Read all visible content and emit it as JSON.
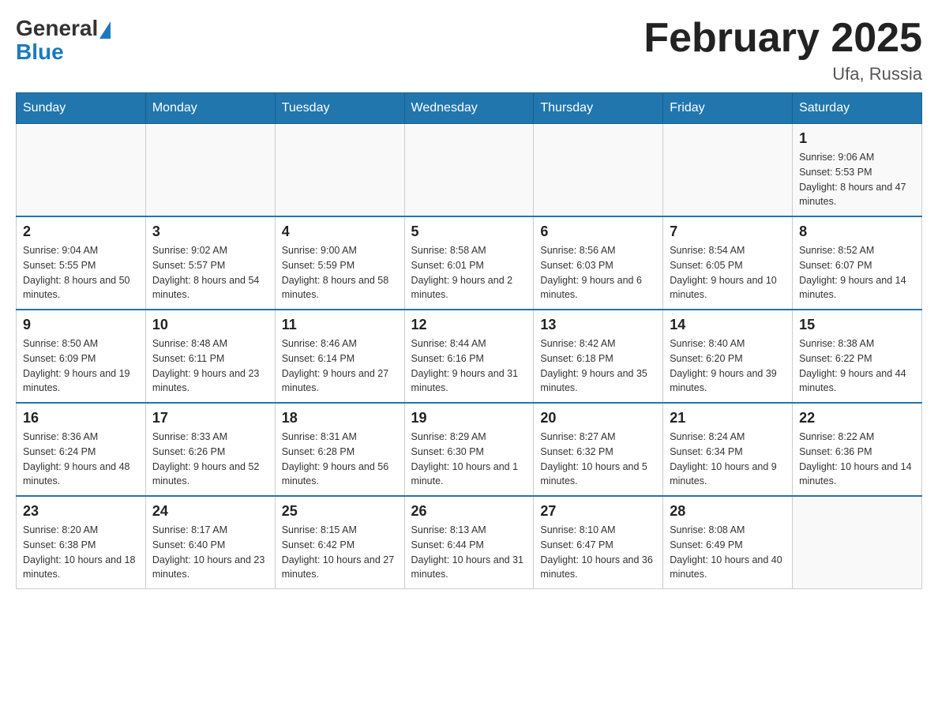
{
  "header": {
    "logo_general": "General",
    "logo_blue": "Blue",
    "title": "February 2025",
    "location": "Ufa, Russia"
  },
  "days_of_week": [
    "Sunday",
    "Monday",
    "Tuesday",
    "Wednesday",
    "Thursday",
    "Friday",
    "Saturday"
  ],
  "weeks": [
    [
      {
        "day": "",
        "info": ""
      },
      {
        "day": "",
        "info": ""
      },
      {
        "day": "",
        "info": ""
      },
      {
        "day": "",
        "info": ""
      },
      {
        "day": "",
        "info": ""
      },
      {
        "day": "",
        "info": ""
      },
      {
        "day": "1",
        "info": "Sunrise: 9:06 AM\nSunset: 5:53 PM\nDaylight: 8 hours and 47 minutes."
      }
    ],
    [
      {
        "day": "2",
        "info": "Sunrise: 9:04 AM\nSunset: 5:55 PM\nDaylight: 8 hours and 50 minutes."
      },
      {
        "day": "3",
        "info": "Sunrise: 9:02 AM\nSunset: 5:57 PM\nDaylight: 8 hours and 54 minutes."
      },
      {
        "day": "4",
        "info": "Sunrise: 9:00 AM\nSunset: 5:59 PM\nDaylight: 8 hours and 58 minutes."
      },
      {
        "day": "5",
        "info": "Sunrise: 8:58 AM\nSunset: 6:01 PM\nDaylight: 9 hours and 2 minutes."
      },
      {
        "day": "6",
        "info": "Sunrise: 8:56 AM\nSunset: 6:03 PM\nDaylight: 9 hours and 6 minutes."
      },
      {
        "day": "7",
        "info": "Sunrise: 8:54 AM\nSunset: 6:05 PM\nDaylight: 9 hours and 10 minutes."
      },
      {
        "day": "8",
        "info": "Sunrise: 8:52 AM\nSunset: 6:07 PM\nDaylight: 9 hours and 14 minutes."
      }
    ],
    [
      {
        "day": "9",
        "info": "Sunrise: 8:50 AM\nSunset: 6:09 PM\nDaylight: 9 hours and 19 minutes."
      },
      {
        "day": "10",
        "info": "Sunrise: 8:48 AM\nSunset: 6:11 PM\nDaylight: 9 hours and 23 minutes."
      },
      {
        "day": "11",
        "info": "Sunrise: 8:46 AM\nSunset: 6:14 PM\nDaylight: 9 hours and 27 minutes."
      },
      {
        "day": "12",
        "info": "Sunrise: 8:44 AM\nSunset: 6:16 PM\nDaylight: 9 hours and 31 minutes."
      },
      {
        "day": "13",
        "info": "Sunrise: 8:42 AM\nSunset: 6:18 PM\nDaylight: 9 hours and 35 minutes."
      },
      {
        "day": "14",
        "info": "Sunrise: 8:40 AM\nSunset: 6:20 PM\nDaylight: 9 hours and 39 minutes."
      },
      {
        "day": "15",
        "info": "Sunrise: 8:38 AM\nSunset: 6:22 PM\nDaylight: 9 hours and 44 minutes."
      }
    ],
    [
      {
        "day": "16",
        "info": "Sunrise: 8:36 AM\nSunset: 6:24 PM\nDaylight: 9 hours and 48 minutes."
      },
      {
        "day": "17",
        "info": "Sunrise: 8:33 AM\nSunset: 6:26 PM\nDaylight: 9 hours and 52 minutes."
      },
      {
        "day": "18",
        "info": "Sunrise: 8:31 AM\nSunset: 6:28 PM\nDaylight: 9 hours and 56 minutes."
      },
      {
        "day": "19",
        "info": "Sunrise: 8:29 AM\nSunset: 6:30 PM\nDaylight: 10 hours and 1 minute."
      },
      {
        "day": "20",
        "info": "Sunrise: 8:27 AM\nSunset: 6:32 PM\nDaylight: 10 hours and 5 minutes."
      },
      {
        "day": "21",
        "info": "Sunrise: 8:24 AM\nSunset: 6:34 PM\nDaylight: 10 hours and 9 minutes."
      },
      {
        "day": "22",
        "info": "Sunrise: 8:22 AM\nSunset: 6:36 PM\nDaylight: 10 hours and 14 minutes."
      }
    ],
    [
      {
        "day": "23",
        "info": "Sunrise: 8:20 AM\nSunset: 6:38 PM\nDaylight: 10 hours and 18 minutes."
      },
      {
        "day": "24",
        "info": "Sunrise: 8:17 AM\nSunset: 6:40 PM\nDaylight: 10 hours and 23 minutes."
      },
      {
        "day": "25",
        "info": "Sunrise: 8:15 AM\nSunset: 6:42 PM\nDaylight: 10 hours and 27 minutes."
      },
      {
        "day": "26",
        "info": "Sunrise: 8:13 AM\nSunset: 6:44 PM\nDaylight: 10 hours and 31 minutes."
      },
      {
        "day": "27",
        "info": "Sunrise: 8:10 AM\nSunset: 6:47 PM\nDaylight: 10 hours and 36 minutes."
      },
      {
        "day": "28",
        "info": "Sunrise: 8:08 AM\nSunset: 6:49 PM\nDaylight: 10 hours and 40 minutes."
      },
      {
        "day": "",
        "info": ""
      }
    ]
  ]
}
